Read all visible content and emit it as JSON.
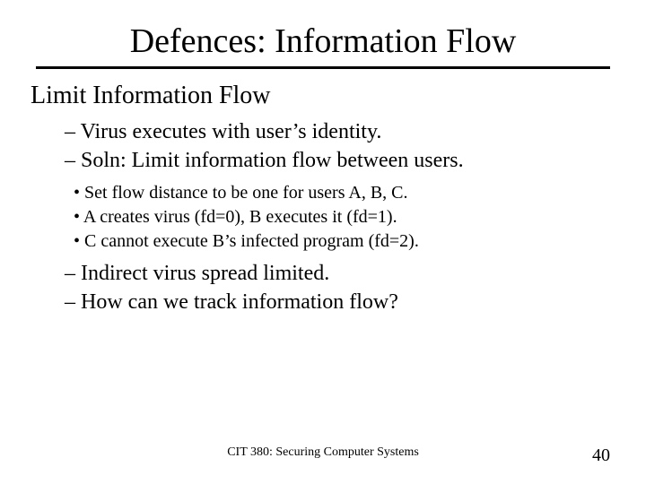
{
  "title": "Defences: Information Flow",
  "subtitle": "Limit Information Flow",
  "points_a": [
    "Virus executes with user’s identity.",
    "Soln: Limit information flow between users."
  ],
  "subpoints": [
    "Set flow distance to be one for users A, B, C.",
    "A creates virus (fd=0), B executes it (fd=1).",
    "C cannot execute B’s infected program (fd=2)."
  ],
  "points_b": [
    "Indirect virus spread limited.",
    "How can we track information flow?"
  ],
  "footer": {
    "course": "CIT 380: Securing Computer Systems",
    "page": "40"
  }
}
